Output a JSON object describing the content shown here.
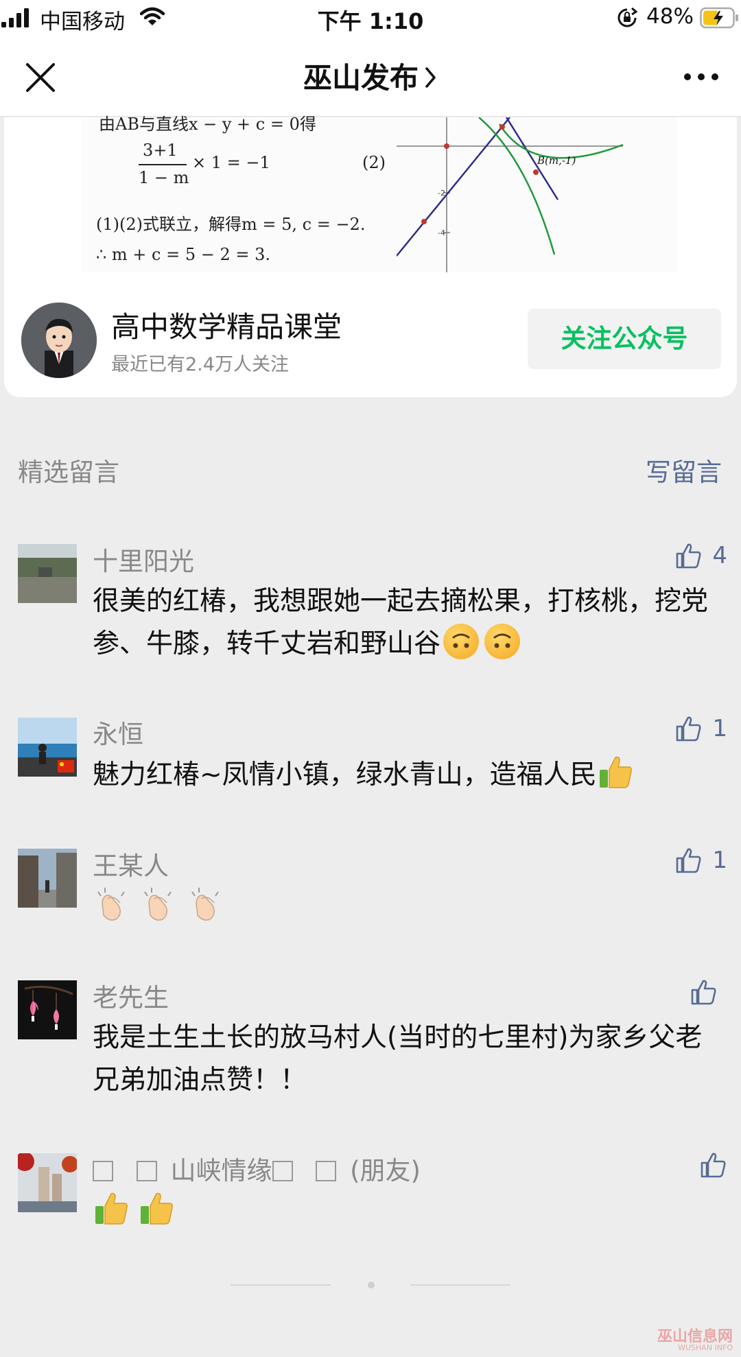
{
  "status_bar": {
    "carrier": "中国移动",
    "time": "下午 1:10",
    "battery_percent": "48%"
  },
  "nav": {
    "title": "巫山发布"
  },
  "article_figure": {
    "line1": "由AB与直线x − y + c = 0得",
    "frac_num": "3+1",
    "frac_den": "1 − m",
    "frac_tail": "× 1 = −1",
    "eq_no": "(2)",
    "line3": "(1)(2)式联立，解得m = 5, c = −2.",
    "line4": "∴ m + c = 5 − 2 = 3.",
    "point_label": "B(m,-1)"
  },
  "account": {
    "name": "高中数学精品课堂",
    "followers": "最近已有2.4万人关注",
    "follow_label": "关注公众号"
  },
  "comments_header": {
    "title": "精选留言",
    "write_label": "写留言"
  },
  "comments": [
    {
      "name": "十里阳光",
      "likes": "4",
      "text": "很美的红椿，我想跟她一起去摘松果，打核桃，挖党参、牛膝，转千丈岩和野山谷"
    },
    {
      "name": "永恒",
      "likes": "1",
      "text": "魅力红椿~凤情小镇，绿水青山，造福人民"
    },
    {
      "name": "王某人",
      "likes": "1",
      "text": ""
    },
    {
      "name": "老先生",
      "likes": "",
      "text": "我是土生土长的放马村人(当时的七里村)为家乡父老兄弟加油点赞！！"
    },
    {
      "name": "山峡情缘",
      "name_suffix": "(朋友)",
      "likes": "",
      "text": ""
    }
  ],
  "watermark": {
    "main": "巫山信息网",
    "sub": "WUSHAN INFO"
  },
  "colors": {
    "accent_green": "#07c160",
    "link_blue": "#576b95",
    "background": "#ededed"
  }
}
